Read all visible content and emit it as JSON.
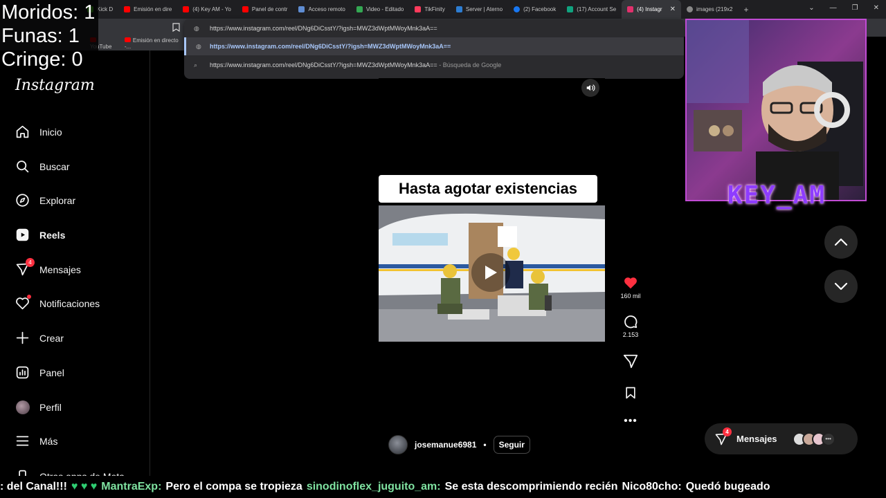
{
  "browser": {
    "tabs": [
      {
        "label": "Kick D",
        "color": "#53fc18"
      },
      {
        "label": "Emisión en dire",
        "color": "#ff0000"
      },
      {
        "label": "(4) Key AM - Yo",
        "color": "#ff0000"
      },
      {
        "label": "Panel de contr",
        "color": "#ff0000"
      },
      {
        "label": "Acceso remoto",
        "color": "#5f8dd3"
      },
      {
        "label": "Video - Editado",
        "color": "#34a853"
      },
      {
        "label": "TikFinity",
        "color": "#ff3b5c"
      },
      {
        "label": "Server | Aterno",
        "color": "#2d7dd2"
      },
      {
        "label": "(2) Facebook",
        "color": "#1877f2"
      },
      {
        "label": "(17) Account Se",
        "color": "#10a37f"
      },
      {
        "label": "(4) Instagr",
        "color": "#e1306c",
        "active": true
      },
      {
        "label": "images (219x2",
        "color": "#888888"
      }
    ],
    "bookmarks": [
      {
        "label": "YouTube"
      },
      {
        "label": "Emisión en directo -..."
      }
    ],
    "omnibox": {
      "input": "https://www.instagram.com/reel/DNg6DiCsstY/?igsh=MWZ3dWptMWoyMnk3aA==",
      "suggestion_1": "https://www.instagram.com/reel/DNg6DiCsstY/?igsh=MWZ3dWptMWoyMnk3aA==",
      "suggestion_2": "https://www.instagram.com/reel/DNg6DiCsstY/?igsh=MWZ3dWptMWoyMnk3aA==",
      "suggestion_2_suffix": "- Búsqueda de Google"
    }
  },
  "counter": {
    "line1": "Moridos: 1",
    "line2": "Funas: 1",
    "line3": "Cringe: 0"
  },
  "sidebar": {
    "logo": "Instagram",
    "items": [
      {
        "label": "Inicio",
        "icon": "home-icon"
      },
      {
        "label": "Buscar",
        "icon": "search-icon"
      },
      {
        "label": "Explorar",
        "icon": "compass-icon"
      },
      {
        "label": "Reels",
        "icon": "reels-icon"
      },
      {
        "label": "Mensajes",
        "icon": "messenger-icon",
        "badge": "4"
      },
      {
        "label": "Notificaciones",
        "icon": "heart-icon"
      },
      {
        "label": "Crear",
        "icon": "plus-icon"
      },
      {
        "label": "Panel",
        "icon": "dashboard-icon"
      },
      {
        "label": "Perfil",
        "icon": "avatar"
      },
      {
        "label": "Más",
        "icon": "menu-icon"
      }
    ],
    "more_apps": "Otras apps de Meta"
  },
  "reel": {
    "caption": "Hasta agotar existencias",
    "likes": "160 mil",
    "comments": "2.153",
    "author": "josemanue6981",
    "follow": "Seguir",
    "separator": "•"
  },
  "messages_pill": {
    "label": "Mensajes",
    "badge": "4"
  },
  "webcam": {
    "name": "KEY_AM"
  },
  "chat_ticker": [
    {
      "type": "msg",
      "text": ": del Canal!!!"
    },
    {
      "type": "heart",
      "text": "♥ ♥ ♥"
    },
    {
      "type": "user",
      "text": "MantraExp:"
    },
    {
      "type": "msg",
      "text": "Pero el compa se tropieza"
    },
    {
      "type": "user",
      "text": "sinodinoflex_juguito_am:"
    },
    {
      "type": "msg",
      "text": "Se esta descomprimiendo recién"
    },
    {
      "type": "user2",
      "text": "Nico80cho:"
    },
    {
      "type": "msg",
      "text": "Quedó bugeado"
    }
  ],
  "colors": {
    "accent_blue": "#a8c7fa",
    "notification_red": "#ff3040",
    "liked_red": "#ff3040",
    "stream_purple": "#8e3cff",
    "chat_green": "#7fe3a1"
  }
}
